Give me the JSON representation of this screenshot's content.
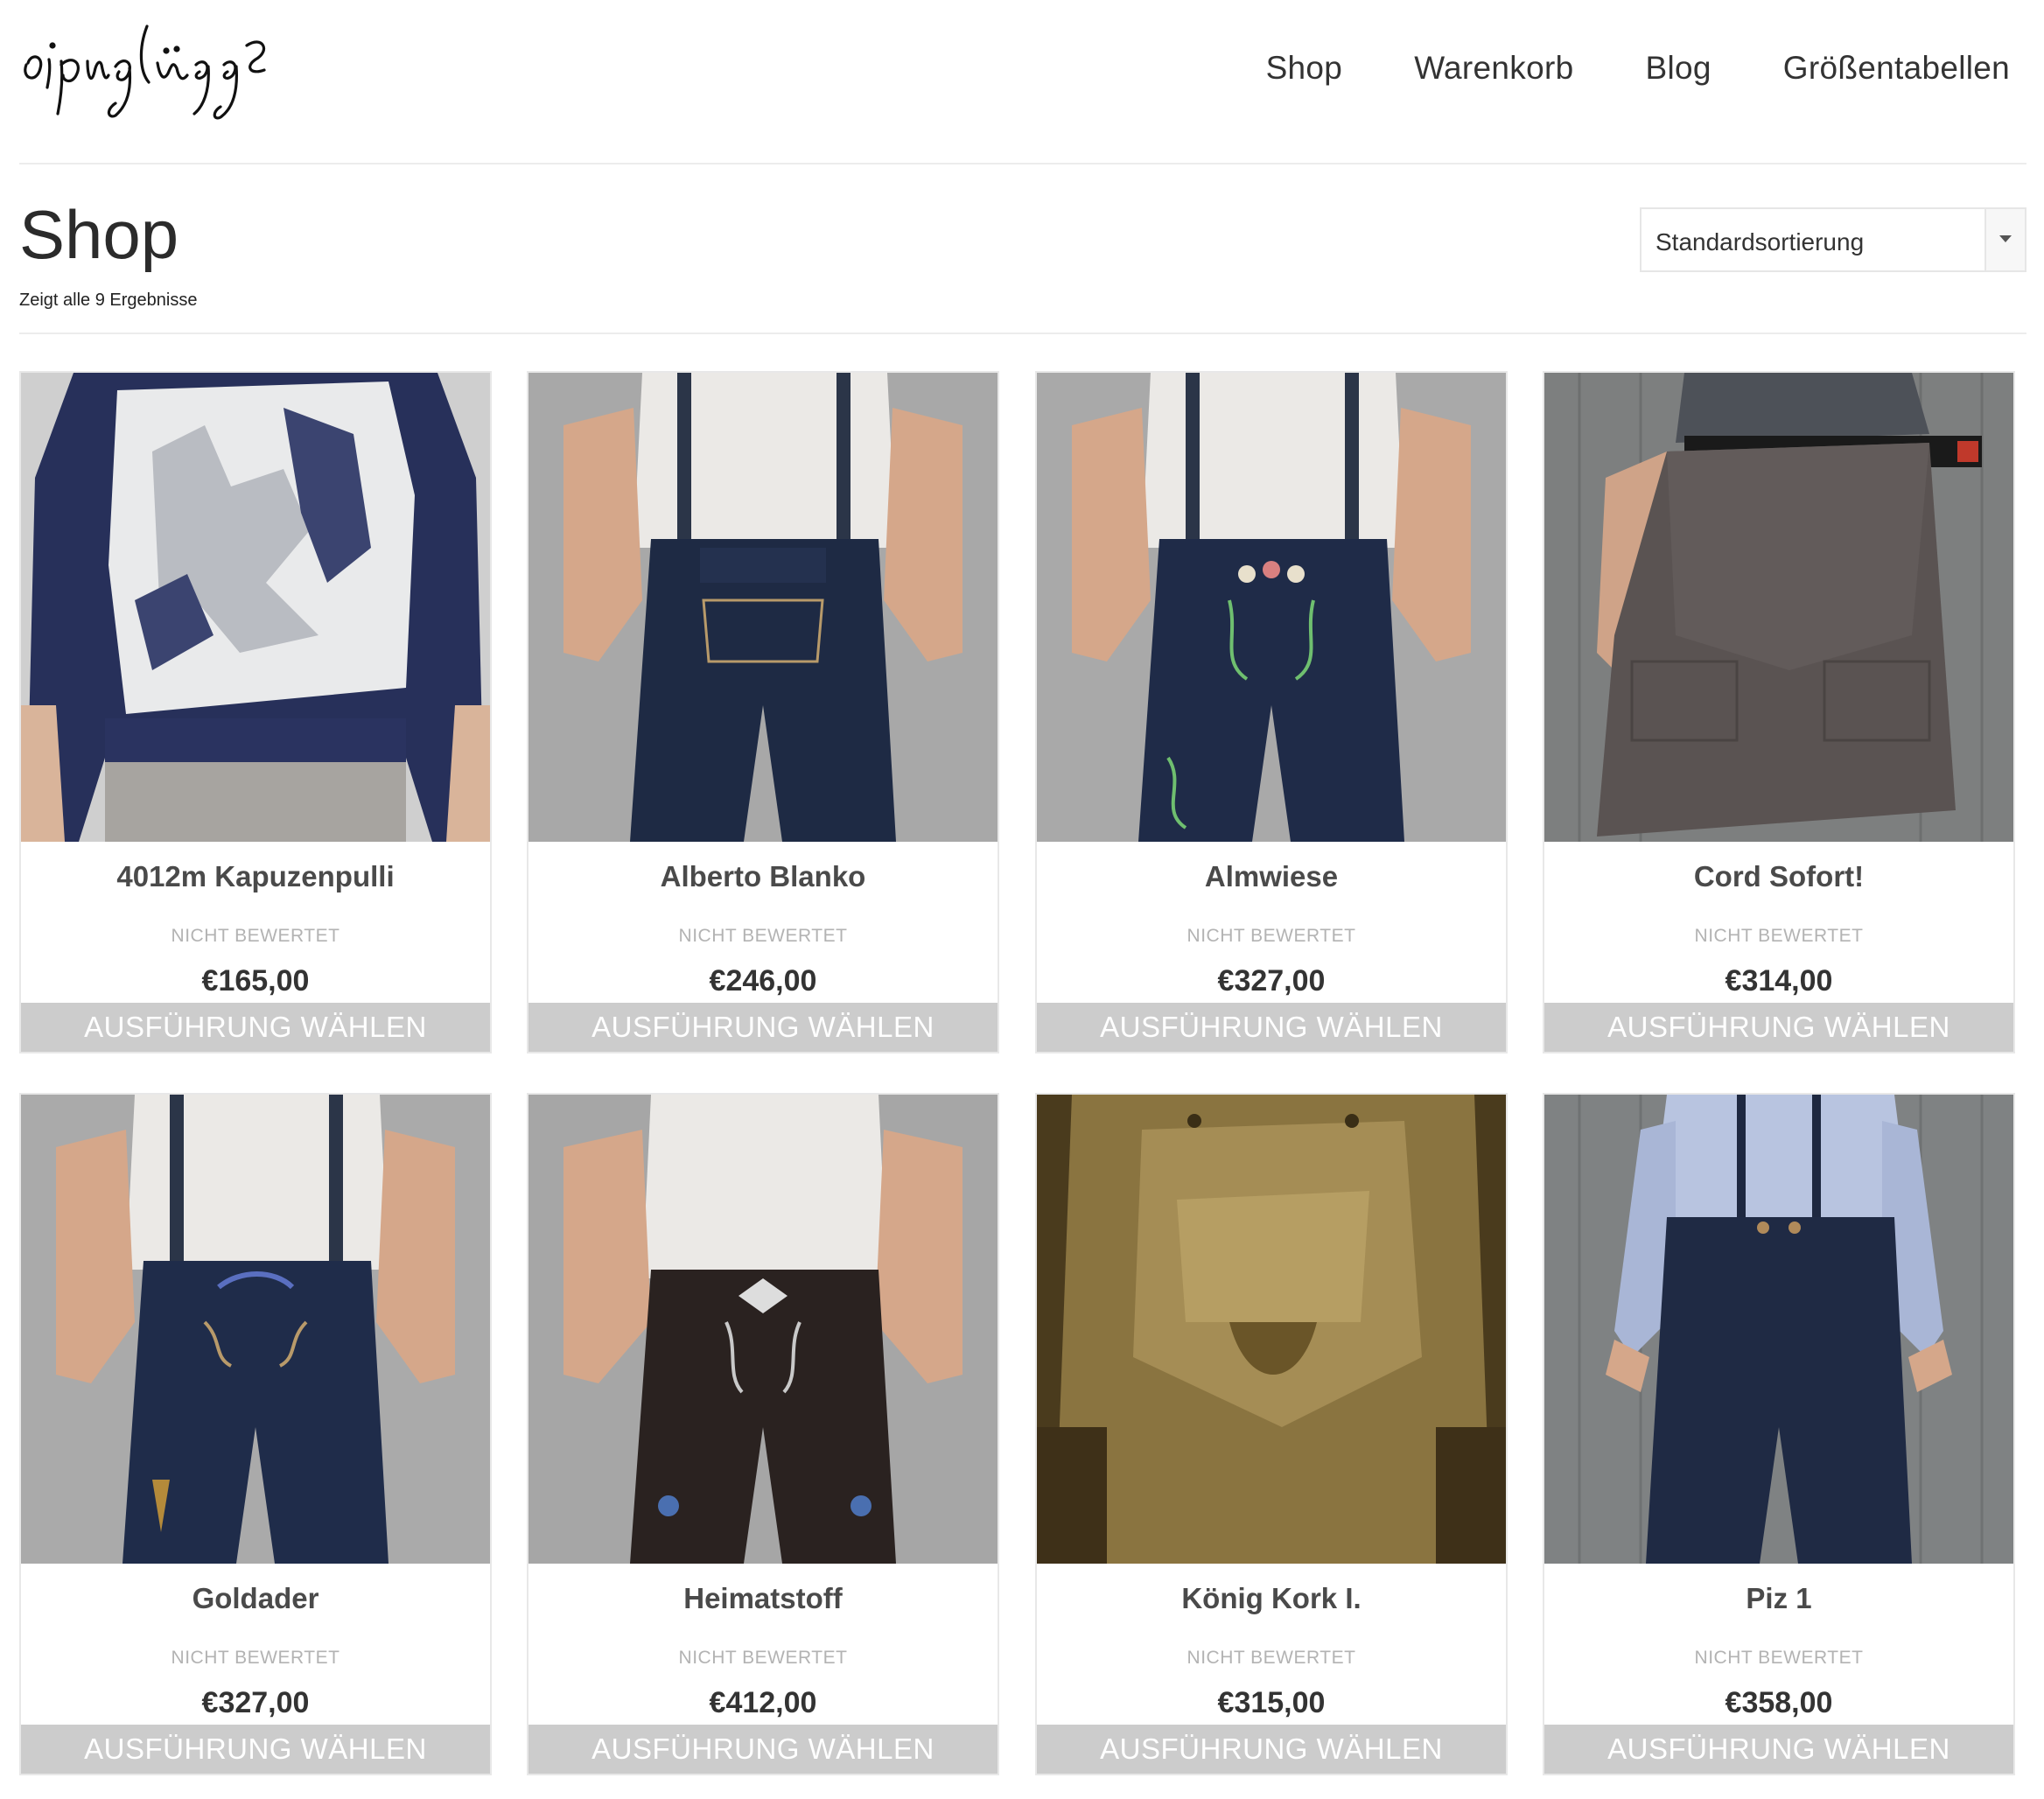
{
  "header": {
    "logo_alt": "oipnglüpp",
    "nav": [
      {
        "label": "Shop"
      },
      {
        "label": "Warenkorb"
      },
      {
        "label": "Blog"
      },
      {
        "label": "Größentabellen"
      }
    ]
  },
  "main": {
    "title": "Shop",
    "results_text": "Zeigt alle 9 Ergebnisse",
    "sort": {
      "selected": "Standardsortierung",
      "icon": "caret-down-icon"
    }
  },
  "products": [
    {
      "name": "4012m Kapuzenpulli",
      "rating": "NICHT BEWERTET",
      "price": "€165,00",
      "button": "AUSFÜHRUNG WÄHLEN"
    },
    {
      "name": "Alberto Blanko",
      "rating": "NICHT BEWERTET",
      "price": "€246,00",
      "button": "AUSFÜHRUNG WÄHLEN"
    },
    {
      "name": "Almwiese",
      "rating": "NICHT BEWERTET",
      "price": "€327,00",
      "button": "AUSFÜHRUNG WÄHLEN"
    },
    {
      "name": "Cord Sofort!",
      "rating": "NICHT BEWERTET",
      "price": "€314,00",
      "button": "AUSFÜHRUNG WÄHLEN"
    },
    {
      "name": "Goldader",
      "rating": "NICHT BEWERTET",
      "price": "€327,00",
      "button": "AUSFÜHRUNG WÄHLEN"
    },
    {
      "name": "Heimatstoff",
      "rating": "NICHT BEWERTET",
      "price": "€412,00",
      "button": "AUSFÜHRUNG WÄHLEN"
    },
    {
      "name": "König Kork I.",
      "rating": "NICHT BEWERTET",
      "price": "€315,00",
      "button": "AUSFÜHRUNG WÄHLEN"
    },
    {
      "name": "Piz 1",
      "rating": "NICHT BEWERTET",
      "price": "€358,00",
      "button": "AUSFÜHRUNG WÄHLEN"
    }
  ],
  "colors": {
    "button_bg": "#cccccc",
    "button_text": "#ffffff",
    "rating_text": "#b3b3b3"
  }
}
